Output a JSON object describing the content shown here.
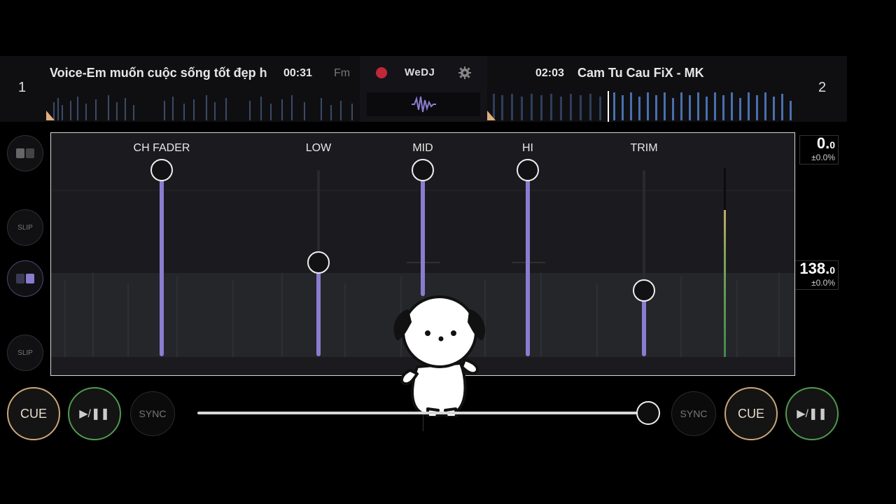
{
  "deck1": {
    "number": "1",
    "title": "Voice-Em muốn cuộc sống tốt đẹp h",
    "time": "00:31",
    "key": "Fm",
    "bpm_main": "0.",
    "bpm_decimal": "0",
    "pitch": "±0.0%"
  },
  "deck2": {
    "number": "2",
    "title": "Cam Tu Cau FiX - MK",
    "time": "02:03",
    "bpm_main": "138.",
    "bpm_decimal": "0",
    "pitch": "±0.0%"
  },
  "center": {
    "app_name": "WeDJ",
    "record_icon": "record-icon",
    "settings_icon": "gear-icon",
    "waveform_icon": "waveform-icon"
  },
  "left_buttons": [
    {
      "label": "",
      "icon": "view-toggle-icon"
    },
    {
      "label": "SLIP"
    },
    {
      "label": "",
      "icon": "view-toggle-icon"
    },
    {
      "label": "SLIP"
    }
  ],
  "mixer": {
    "channels": [
      {
        "label": "CH FADER",
        "level": 1.0
      },
      {
        "label": "LOW",
        "level": 0.5
      },
      {
        "label": "MID",
        "level": 1.0
      },
      {
        "label": "HI",
        "level": 1.0
      },
      {
        "label": "TRIM",
        "level": 0.35
      }
    ]
  },
  "bottom": {
    "cue_label": "CUE",
    "play_label": "▶/❚❚",
    "sync_label": "SYNC",
    "crossfader_position": 1.0
  },
  "colors": {
    "fader_fill": "#8b7ccf",
    "cue_ring": "#c9a77a",
    "play_ring": "#4e9b4e",
    "record": "#c0283a"
  }
}
